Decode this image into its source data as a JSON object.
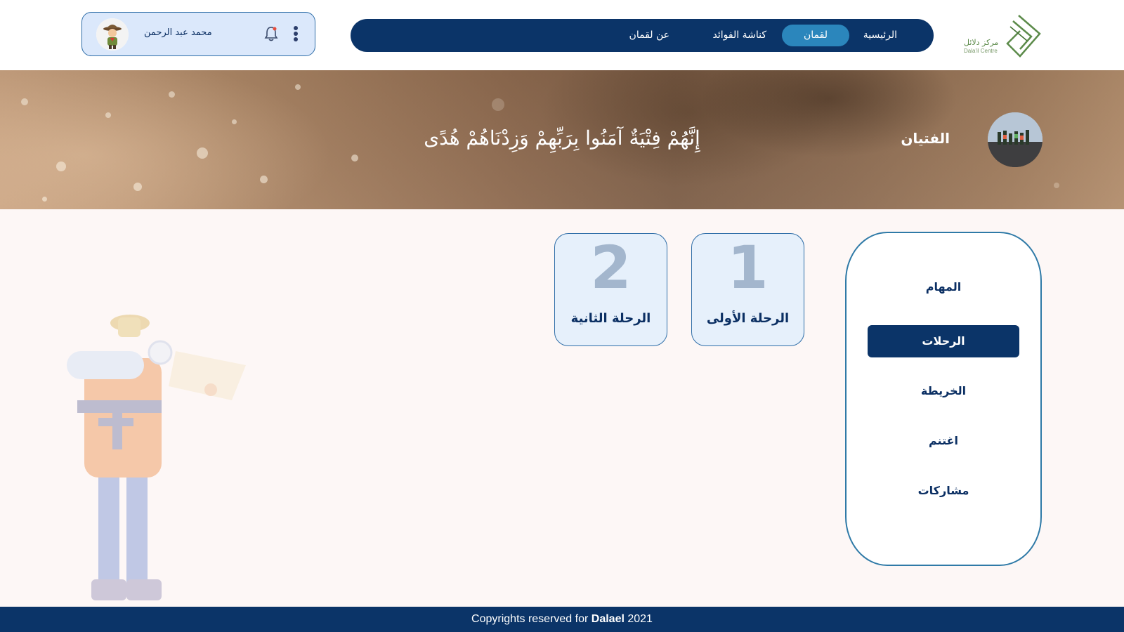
{
  "header": {
    "logo": {
      "text_ar": "مركز دلائل",
      "text_en": "Dala'il Centre",
      "accent": "#5c8b4a",
      "icon": "dalaail-logo-icon"
    },
    "nav": {
      "home": "الرئيسية",
      "luqman": "لقمان",
      "kunnasha": "كناشة الفوائد",
      "about": "عن لقمان",
      "active": "لقمان",
      "background": "#0b3468",
      "active_color": "#2b86bc"
    },
    "user": {
      "name": "محمد عبد الرحمن",
      "avatar_icon": "scout-avatar-icon",
      "bell_icon": "bell-icon",
      "menu_icon": "kebab-menu-icon"
    }
  },
  "banner": {
    "title": "الفتيان",
    "verse": "إِنَّهُمْ فِتْيَةٌ آمَنُوا بِرَبِّهِمْ وَزِدْنَاهُمْ هُدًى"
  },
  "sidebar": {
    "items": [
      {
        "label": "المهام"
      },
      {
        "label": "الرحلات"
      },
      {
        "label": "الخريطة"
      },
      {
        "label": "اغتنم"
      },
      {
        "label": "مشاركات"
      }
    ],
    "active": "الرحلات"
  },
  "trips": [
    {
      "number": "1",
      "label": "الرحلة الأولى"
    },
    {
      "number": "2",
      "label": "الرحلة الثانية"
    }
  ],
  "footer": {
    "prefix": "Copyrights reserved for ",
    "brand": "Dalael",
    "year": " 2021"
  }
}
